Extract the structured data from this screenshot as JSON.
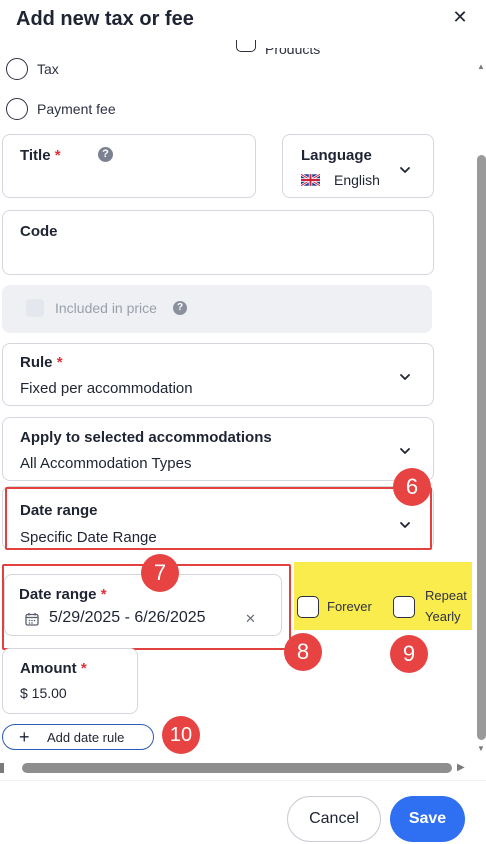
{
  "dialog": {
    "title": "Add new tax or fee",
    "close_glyph": "✕"
  },
  "type_options": {
    "tax_label": "Tax",
    "payment_fee_label": "Payment fee",
    "products_label": "Products"
  },
  "title_field": {
    "label": "Title",
    "required_mark": "*",
    "help_glyph": "?",
    "value": ""
  },
  "language_field": {
    "label": "Language",
    "value": "English",
    "flag": "uk-flag-icon"
  },
  "code_field": {
    "label": "Code",
    "value": ""
  },
  "included_in_price": {
    "label": "Included in price",
    "help_glyph": "?",
    "disabled": true
  },
  "rule_field": {
    "label": "Rule",
    "required_mark": "*",
    "value": "Fixed per accommodation"
  },
  "accommodations_field": {
    "label": "Apply to selected accommodations",
    "value": "All Accommodation Types"
  },
  "date_range_select": {
    "label": "Date range",
    "value": "Specific Date Range"
  },
  "date_range_input": {
    "label": "Date range",
    "required_mark": "*",
    "value": "5/29/2025 - 6/26/2025",
    "clear_glyph": "✕"
  },
  "forever_option": {
    "label": "Forever"
  },
  "repeat_option": {
    "label_line1": "Repeat",
    "label_line2": "Yearly"
  },
  "amount_field": {
    "label": "Amount",
    "required_mark": "*",
    "value": "$ 15.00"
  },
  "add_date_rule": {
    "icon": "+",
    "label": "Add date rule"
  },
  "annotations": {
    "b6": "6",
    "b7": "7",
    "b8": "8",
    "b9": "9",
    "b10": "10"
  },
  "footer": {
    "cancel_label": "Cancel",
    "save_label": "Save"
  },
  "colors": {
    "accent": "#2f6ff2",
    "required": "#e0313b",
    "annotation": "#e84343",
    "highlight": "#faec4d"
  }
}
